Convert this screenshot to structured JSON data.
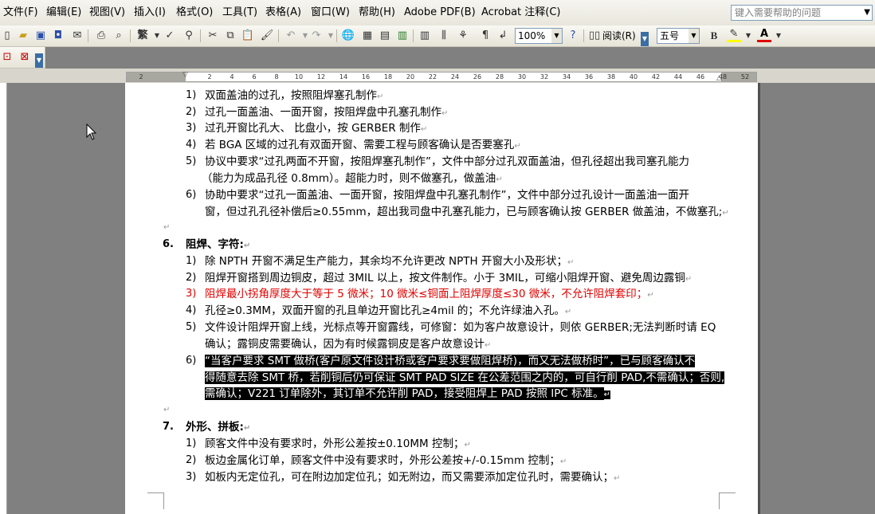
{
  "menu": [
    "文件(F)",
    "编辑(E)",
    "视图(V)",
    "插入(I)",
    "格式(O)",
    "工具(T)",
    "表格(A)",
    "窗口(W)",
    "帮助(H)",
    "Adobe PDF(B)",
    "Acrobat 注释(C)"
  ],
  "help_placeholder": "键入需要帮助的问题",
  "toolbar": {
    "font_style": "繁",
    "zoom": "100%",
    "read_label": "阅读(R)",
    "font_size": "五号",
    "bold": "B"
  },
  "ruler_ticks": [
    "2",
    "2",
    "4",
    "6",
    "8",
    "10",
    "12",
    "14",
    "16",
    "18",
    "20",
    "22",
    "24",
    "26",
    "28",
    "30",
    "32",
    "34",
    "36",
    "38",
    "40",
    "42",
    "44",
    "46",
    "48",
    "52"
  ],
  "mark": "↵",
  "doc": {
    "list5": [
      {
        "num": "1)",
        "text": "双面盖油的过孔，按照阻焊塞孔制作"
      },
      {
        "num": "2)",
        "text": "过孔一面盖油、一面开窗，按阻焊盘中孔塞孔制作"
      },
      {
        "num": "3)",
        "text": "过孔开窗比孔大、 比盘小，按 GERBER 制作"
      },
      {
        "num": "4)",
        "text": "若 BGA 区域的过孔有双面开窗、需要工程与顾客确认是否要塞孔"
      },
      {
        "num": "5)",
        "text": "协议中要求“过孔两面不开窗，按阻焊塞孔制作”，文件中部分过孔双面盖油，但孔径超出我司塞孔能力",
        "cont": "（能力为成品孔径 0.8mm）。超能力时，则不做塞孔，做盖油"
      },
      {
        "num": "6)",
        "text": "协助中要求“过孔一面盖油、一面开窗，按阻焊盘中孔塞孔制作”，文件中部分过孔设计一面盖油一面开",
        "cont": "窗，但过孔孔径补偿后≥0.55mm，超出我司盘中孔塞孔能力，已与顾客确认按 GERBER 做盖油，不做塞孔;"
      }
    ],
    "section6": {
      "num": "6.",
      "title": "阻焊、字符:"
    },
    "list6": [
      {
        "num": "1)",
        "text": "除 NPTH 开窗不满足生产能力，其余均不允许更改 NPTH 开窗大小及形状；"
      },
      {
        "num": "2)",
        "text": "阻焊开窗搭到周边铜皮，超过 3MIL 以上，按文件制作。小于 3MIL，可缩小阻焊开窗、避免周边露铜"
      },
      {
        "num": "3)",
        "text": "阻焊最小拐角厚度大于等于 5 微米；10 微米≤铜面上阻焊厚度≤30 微米，不允许阻焊套印；"
      },
      {
        "num": "4)",
        "text": "孔径≥0.3MM，双面开窗的孔且单边开窗比孔≥4mil 的；不允许绿油入孔。"
      },
      {
        "num": "5)",
        "text": "文件设计阻焊开窗上线，光标点等开窗露线，可修窗：如为客户故意设计，则依 GERBER;无法判断时请 EQ",
        "cont": "确认；露铜皮需要确认，因为有时候露铜皮是客户故意设计"
      },
      {
        "num": "6)",
        "text": "“当客户要求 SMT 做桥(客户原文件设计桥或客户要求要做阻焊桥)，而又无法做桥时”，已与顾客确认不",
        "cont": "得随意去除 SMT 桥，若削铜后仍可保证 SMT PAD SIZE 在公差范围之内的，可自行削 PAD,不需确认；否则,",
        "cont2": "需确认；V221 订单除外，其订单不允许削 PAD，接受阻焊上 PAD 按照 IPC 标准。"
      }
    ],
    "section7": {
      "num": "7.",
      "title": "外形、拼板:"
    },
    "list7": [
      {
        "num": "1)",
        "text": "顾客文件中没有要求时，外形公差按±0.10MM 控制；"
      },
      {
        "num": "2)",
        "text": "板边金属化订单，顾客文件中没有要求时，外形公差按+/-0.15mm 控制；"
      },
      {
        "num": "3)",
        "text": "如板内无定位孔，可在附边加定位孔；如无附边，而又需要添加定位孔时，需要确认；"
      }
    ]
  }
}
